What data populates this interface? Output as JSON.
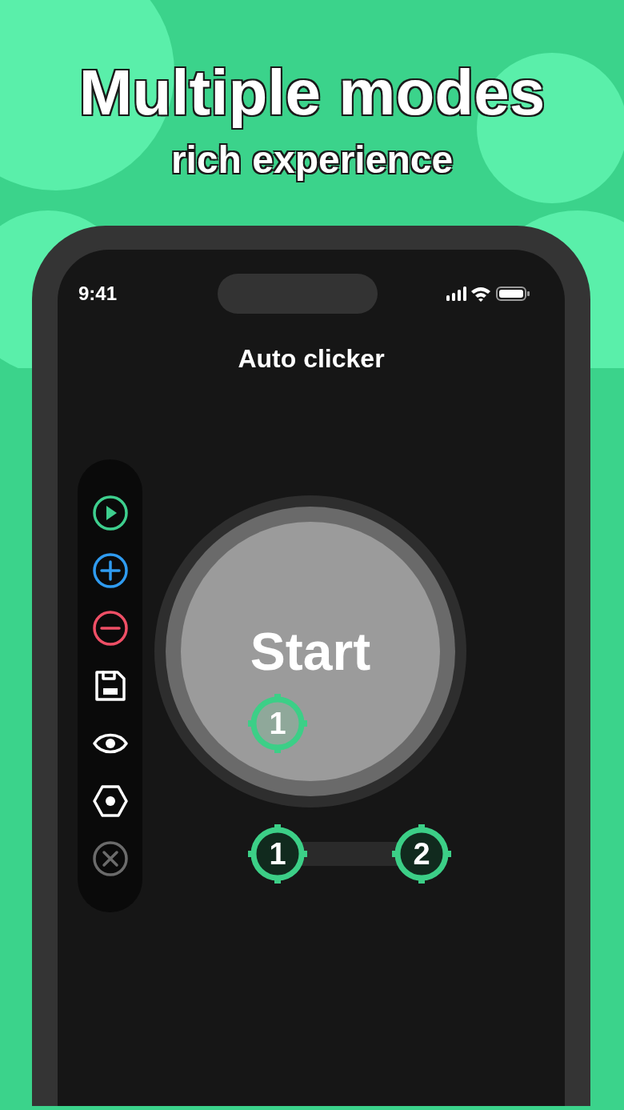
{
  "headline": "Multiple modes",
  "subheadline": "rich experience",
  "status_bar": {
    "time": "9:41"
  },
  "title": "Auto clicker",
  "toolbar": [
    {
      "kind": "play",
      "disabled": false
    },
    {
      "kind": "add",
      "disabled": false
    },
    {
      "kind": "remove",
      "disabled": false
    },
    {
      "kind": "save",
      "disabled": false
    },
    {
      "kind": "view",
      "disabled": false
    },
    {
      "kind": "settings",
      "disabled": false
    },
    {
      "kind": "close",
      "disabled": true
    }
  ],
  "start_button": {
    "label": "Start",
    "target": {
      "label": "1"
    }
  },
  "swipe_targets": [
    {
      "label": "1"
    },
    {
      "label": "2"
    }
  ]
}
